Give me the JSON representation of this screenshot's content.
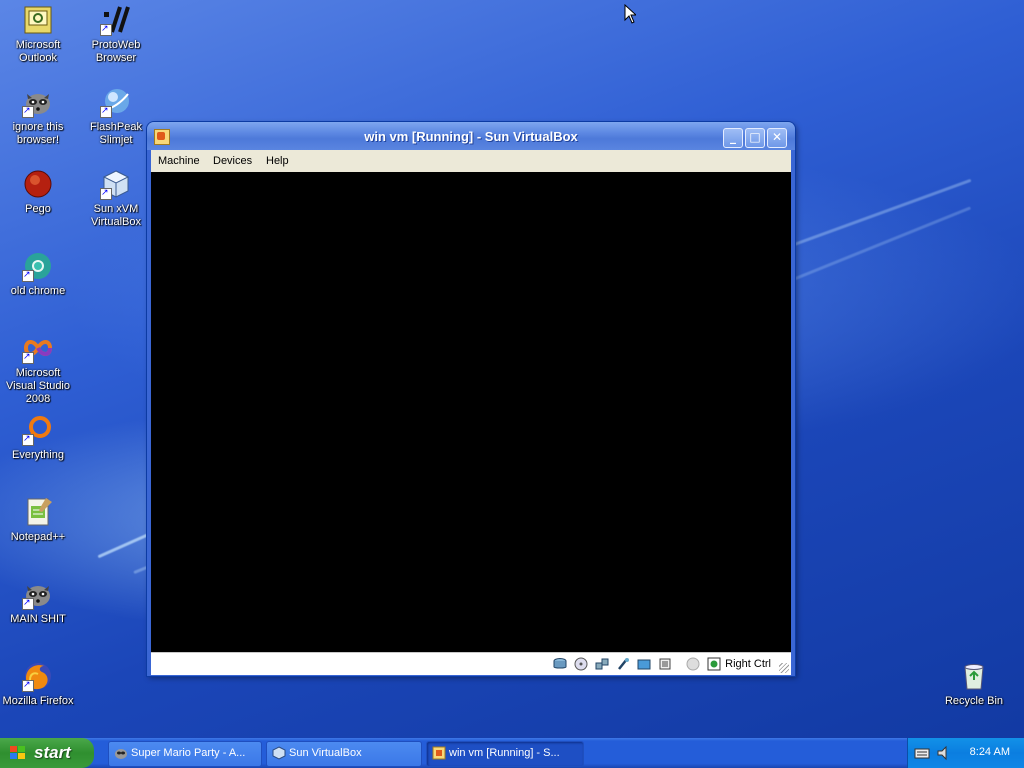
{
  "desktop": {
    "icons_left": [
      {
        "label": "Microsoft Outlook",
        "icon": "outlook-icon"
      },
      {
        "label": "ignore this browser!",
        "icon": "raccoon-icon"
      },
      {
        "label": "Pego",
        "icon": "pego-icon"
      },
      {
        "label": "old chrome",
        "icon": "chrome-icon"
      },
      {
        "label": "Microsoft Visual Studio 2008",
        "icon": "visual-studio-icon"
      },
      {
        "label": "Everything",
        "icon": "everything-icon"
      },
      {
        "label": "Notepad++",
        "icon": "notepadpp-icon"
      },
      {
        "label": "MAIN SHIT",
        "icon": "raccoon-icon"
      },
      {
        "label": "Mozilla Firefox",
        "icon": "firefox-icon"
      }
    ],
    "icons_second": [
      {
        "label": "ProtoWeb Browser",
        "icon": "protoweb-icon"
      },
      {
        "label": "FlashPeak Slimjet",
        "icon": "slimjet-icon"
      },
      {
        "label": "Sun xVM VirtualBox",
        "icon": "virtualbox-icon"
      }
    ],
    "recycle_bin": {
      "label": "Recycle Bin",
      "icon": "recycle-bin-icon"
    }
  },
  "window": {
    "title": "win vm [Running] - Sun VirtualBox",
    "menu": [
      "Machine",
      "Devices",
      "Help"
    ],
    "host_key": "Right Ctrl",
    "status_icons": [
      "hard-disk-icon",
      "cd-icon",
      "network-icon",
      "usb-icon",
      "shared-folder-icon",
      "vrdp-icon",
      "mouse-integration-icon",
      "host-key-icon"
    ],
    "buttons": {
      "minimize": "_",
      "maximize": "□",
      "close": "✕"
    }
  },
  "taskbar": {
    "start_label": "start",
    "tasks": [
      {
        "label": "Super Mario Party - A...",
        "icon": "raccoon-icon",
        "active": false
      },
      {
        "label": "Sun VirtualBox",
        "icon": "virtualbox-icon",
        "active": false
      },
      {
        "label": "win vm [Running] - S...",
        "icon": "virtualbox-vm-icon",
        "active": true
      }
    ],
    "clock": "8:24 AM",
    "tray_icons": [
      "keyboard-icon",
      "volume-icon"
    ]
  },
  "colors": {
    "desktop": "#245dd9",
    "title_bar": "#5c87e2",
    "start_button": "#2f8f2f",
    "tray": "#0b7ee0"
  }
}
